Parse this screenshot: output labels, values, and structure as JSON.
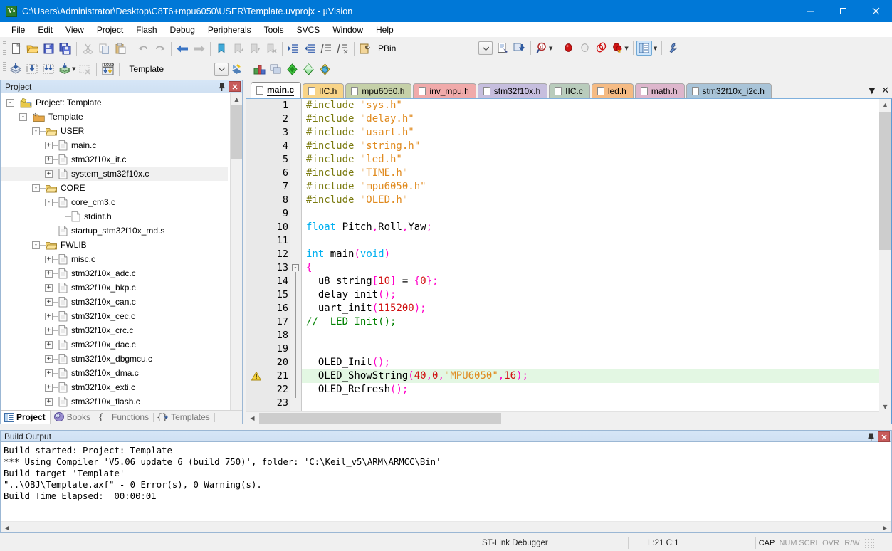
{
  "window": {
    "title": "C:\\Users\\Administrator\\Desktop\\C8T6+mpu6050\\USER\\Template.uvprojx - µVision",
    "app_icon": "keil-uvision-icon",
    "minimize": "—",
    "maximize": "☐",
    "close": "✕",
    "titlebar_color": "#0078d7"
  },
  "menubar": {
    "items": [
      {
        "label": "File"
      },
      {
        "label": "Edit"
      },
      {
        "label": "View"
      },
      {
        "label": "Project"
      },
      {
        "label": "Flash"
      },
      {
        "label": "Debug"
      },
      {
        "label": "Peripherals"
      },
      {
        "label": "Tools"
      },
      {
        "label": "SVCS"
      },
      {
        "label": "Window"
      },
      {
        "label": "Help"
      }
    ]
  },
  "toolbar_main": {
    "buttons": [
      {
        "name": "new-file-icon",
        "tip": "New"
      },
      {
        "name": "open-file-icon",
        "tip": "Open"
      },
      {
        "name": "save-icon",
        "tip": "Save"
      },
      {
        "name": "save-all-icon",
        "tip": "Save All"
      },
      {
        "name": "cut-icon",
        "tip": "Cut"
      },
      {
        "name": "copy-icon",
        "tip": "Copy"
      },
      {
        "name": "paste-icon",
        "tip": "Paste"
      },
      {
        "name": "undo-icon",
        "tip": "Undo"
      },
      {
        "name": "redo-icon",
        "tip": "Redo"
      },
      {
        "name": "navigate-back-icon",
        "tip": "Back"
      },
      {
        "name": "navigate-forward-icon",
        "tip": "Forward"
      },
      {
        "name": "bookmark-toggle-icon",
        "tip": "Insert/Remove Bookmark"
      },
      {
        "name": "bookmark-prev-icon",
        "tip": "Previous Bookmark"
      },
      {
        "name": "bookmark-next-icon",
        "tip": "Next Bookmark"
      },
      {
        "name": "bookmark-clear-icon",
        "tip": "Clear All Bookmarks"
      },
      {
        "name": "indent-icon",
        "tip": "Indent"
      },
      {
        "name": "outdent-icon",
        "tip": "Outdent"
      },
      {
        "name": "comment-icon",
        "tip": "Comment"
      },
      {
        "name": "uncomment-icon",
        "tip": "Uncomment"
      },
      {
        "name": "configure-icon",
        "tip": "Configuration Wizard"
      }
    ],
    "pbin_label": "PBin"
  },
  "toolbar_build": {
    "buttons": [
      {
        "name": "translate-icon",
        "tip": "Translate"
      },
      {
        "name": "build-icon",
        "tip": "Build"
      },
      {
        "name": "rebuild-icon",
        "tip": "Rebuild"
      },
      {
        "name": "batch-build-icon",
        "tip": "Batch Build"
      },
      {
        "name": "stop-build-icon",
        "tip": "Stop Build"
      },
      {
        "name": "download-icon",
        "tip": "Download"
      }
    ],
    "target_value": "Template",
    "target_dropdown_icon": "chevron-down-icon",
    "right_buttons": [
      {
        "name": "target-options-icon",
        "tip": "Options for Target"
      },
      {
        "name": "manage-project-items-icon",
        "tip": "Manage Project Items"
      },
      {
        "name": "pack-installer-icon",
        "tip": "Pack Installer"
      },
      {
        "name": "manage-rte-icon",
        "tip": "Manage Run-Time Environment"
      },
      {
        "name": "select-software-packs-icon",
        "tip": "Select Software Packs"
      }
    ]
  },
  "toolbar_debug": {
    "buttons": [
      {
        "name": "file-info-icon",
        "tip": "Source Browser"
      },
      {
        "name": "debug-session-icon",
        "tip": "Start/Stop Debug Session"
      },
      {
        "name": "find-in-files-icon",
        "tip": "Find in Files"
      },
      {
        "name": "insert-breakpoint-icon",
        "tip": "Insert/Remove Breakpoint"
      },
      {
        "name": "disable-breakpoint-icon",
        "tip": "Enable/Disable Breakpoint"
      },
      {
        "name": "disable-all-breakpoints-icon",
        "tip": "Disable All Breakpoints"
      },
      {
        "name": "kill-all-breakpoints-icon",
        "tip": "Kill All Breakpoints"
      },
      {
        "name": "window-layout-icon",
        "tip": "Window Layout",
        "active": true
      },
      {
        "name": "configure-tools-icon",
        "tip": "Configure"
      }
    ]
  },
  "project_panel": {
    "title": "Project",
    "pin_icon": "pin-icon",
    "close_icon": "close-icon",
    "tree": [
      {
        "label": "Project: Template",
        "depth": 0,
        "toggle": "-",
        "icon": "project-icon",
        "selected": false
      },
      {
        "label": "Template",
        "depth": 1,
        "toggle": "-",
        "icon": "target-icon",
        "selected": false
      },
      {
        "label": "USER",
        "depth": 2,
        "toggle": "-",
        "icon": "folder-icon",
        "selected": false
      },
      {
        "label": "main.c",
        "depth": 3,
        "toggle": "+",
        "icon": "c-file-icon",
        "selected": false
      },
      {
        "label": "stm32f10x_it.c",
        "depth": 3,
        "toggle": "+",
        "icon": "c-file-icon",
        "selected": false
      },
      {
        "label": "system_stm32f10x.c",
        "depth": 3,
        "toggle": "+",
        "icon": "c-file-icon",
        "selected": true
      },
      {
        "label": "CORE",
        "depth": 2,
        "toggle": "-",
        "icon": "folder-icon",
        "selected": false
      },
      {
        "label": "core_cm3.c",
        "depth": 3,
        "toggle": "-",
        "icon": "c-file-icon",
        "selected": false
      },
      {
        "label": "stdint.h",
        "depth": 4,
        "toggle": "",
        "icon": "h-file-icon",
        "selected": false
      },
      {
        "label": "startup_stm32f10x_md.s",
        "depth": 3,
        "toggle": "",
        "icon": "asm-file-icon",
        "selected": false
      },
      {
        "label": "FWLIB",
        "depth": 2,
        "toggle": "-",
        "icon": "folder-icon",
        "selected": false
      },
      {
        "label": "misc.c",
        "depth": 3,
        "toggle": "+",
        "icon": "c-file-icon",
        "selected": false
      },
      {
        "label": "stm32f10x_adc.c",
        "depth": 3,
        "toggle": "+",
        "icon": "c-file-icon",
        "selected": false
      },
      {
        "label": "stm32f10x_bkp.c",
        "depth": 3,
        "toggle": "+",
        "icon": "c-file-icon",
        "selected": false
      },
      {
        "label": "stm32f10x_can.c",
        "depth": 3,
        "toggle": "+",
        "icon": "c-file-icon",
        "selected": false
      },
      {
        "label": "stm32f10x_cec.c",
        "depth": 3,
        "toggle": "+",
        "icon": "c-file-icon",
        "selected": false
      },
      {
        "label": "stm32f10x_crc.c",
        "depth": 3,
        "toggle": "+",
        "icon": "c-file-icon",
        "selected": false
      },
      {
        "label": "stm32f10x_dac.c",
        "depth": 3,
        "toggle": "+",
        "icon": "c-file-icon",
        "selected": false
      },
      {
        "label": "stm32f10x_dbgmcu.c",
        "depth": 3,
        "toggle": "+",
        "icon": "c-file-icon",
        "selected": false
      },
      {
        "label": "stm32f10x_dma.c",
        "depth": 3,
        "toggle": "+",
        "icon": "c-file-icon",
        "selected": false
      },
      {
        "label": "stm32f10x_exti.c",
        "depth": 3,
        "toggle": "+",
        "icon": "c-file-icon",
        "selected": false
      },
      {
        "label": "stm32f10x_flash.c",
        "depth": 3,
        "toggle": "+",
        "icon": "c-file-icon",
        "selected": false
      }
    ],
    "bottom_tabs": [
      {
        "label": "Project",
        "icon": "project-tab-icon",
        "active": true
      },
      {
        "label": "Books",
        "icon": "books-tab-icon",
        "active": false
      },
      {
        "label": "Functions",
        "icon": "functions-tab-icon",
        "active": false
      },
      {
        "label": "Templates",
        "icon": "templates-tab-icon",
        "active": false
      }
    ]
  },
  "editor": {
    "tabs": [
      {
        "label": "main.c",
        "color": "#ffffff",
        "active": true
      },
      {
        "label": "IIC.h",
        "color": "#f8d488",
        "active": false
      },
      {
        "label": "mpu6050.h",
        "color": "#c5d0a8",
        "active": false
      },
      {
        "label": "inv_mpu.h",
        "color": "#f0aaaa",
        "active": false
      },
      {
        "label": "stm32f10x.h",
        "color": "#c6bede",
        "active": false
      },
      {
        "label": "IIC.c",
        "color": "#b9ccbc",
        "active": false
      },
      {
        "label": "led.h",
        "color": "#f5bb84",
        "active": false
      },
      {
        "label": "math.h",
        "color": "#ddb6cc",
        "active": false
      },
      {
        "label": "stm32f10x_i2c.h",
        "color": "#a9c4d8",
        "active": false
      }
    ],
    "tab_list_icon": "tab-list-icon",
    "tab_close_icon": "close-icon",
    "lines": [
      {
        "n": "1",
        "tokens": [
          {
            "t": "#include ",
            "c": "pre"
          },
          {
            "t": "\"sys.h\"",
            "c": "str"
          }
        ]
      },
      {
        "n": "2",
        "tokens": [
          {
            "t": "#include ",
            "c": "pre"
          },
          {
            "t": "\"delay.h\"",
            "c": "str"
          }
        ]
      },
      {
        "n": "3",
        "tokens": [
          {
            "t": "#include ",
            "c": "pre"
          },
          {
            "t": "\"usart.h\"",
            "c": "str"
          }
        ]
      },
      {
        "n": "4",
        "tokens": [
          {
            "t": "#include ",
            "c": "pre"
          },
          {
            "t": "\"string.h\"",
            "c": "str"
          }
        ]
      },
      {
        "n": "5",
        "tokens": [
          {
            "t": "#include ",
            "c": "pre"
          },
          {
            "t": "\"led.h\"",
            "c": "str"
          }
        ]
      },
      {
        "n": "6",
        "tokens": [
          {
            "t": "#include ",
            "c": "pre"
          },
          {
            "t": "\"TIME.h\"",
            "c": "str"
          }
        ]
      },
      {
        "n": "7",
        "tokens": [
          {
            "t": "#include ",
            "c": "pre"
          },
          {
            "t": "\"mpu6050.h\"",
            "c": "str"
          }
        ]
      },
      {
        "n": "8",
        "tokens": [
          {
            "t": "#include ",
            "c": "pre"
          },
          {
            "t": "\"OLED.h\"",
            "c": "str"
          }
        ]
      },
      {
        "n": "9",
        "tokens": []
      },
      {
        "n": "10",
        "tokens": [
          {
            "t": "float",
            "c": "type"
          },
          {
            "t": " Pitch",
            "c": "txt"
          },
          {
            "t": ",",
            "c": "punc"
          },
          {
            "t": "Roll",
            "c": "txt"
          },
          {
            "t": ",",
            "c": "punc"
          },
          {
            "t": "Yaw",
            "c": "txt"
          },
          {
            "t": ";",
            "c": "punc"
          }
        ]
      },
      {
        "n": "11",
        "tokens": []
      },
      {
        "n": "12",
        "tokens": [
          {
            "t": "int",
            "c": "type"
          },
          {
            "t": " main",
            "c": "txt"
          },
          {
            "t": "(",
            "c": "punc"
          },
          {
            "t": "void",
            "c": "type"
          },
          {
            "t": ")",
            "c": "punc"
          }
        ]
      },
      {
        "n": "13",
        "tokens": [
          {
            "t": "{",
            "c": "punc"
          }
        ],
        "fold": true
      },
      {
        "n": "14",
        "tokens": [
          {
            "t": "  u8 string",
            "c": "txt"
          },
          {
            "t": "[",
            "c": "punc"
          },
          {
            "t": "10",
            "c": "num"
          },
          {
            "t": "]",
            "c": "punc"
          },
          {
            "t": " = ",
            "c": "txt"
          },
          {
            "t": "{",
            "c": "punc"
          },
          {
            "t": "0",
            "c": "num"
          },
          {
            "t": "}",
            "c": "punc"
          },
          {
            "t": ";",
            "c": "punc"
          }
        ]
      },
      {
        "n": "15",
        "tokens": [
          {
            "t": "  delay_init",
            "c": "txt"
          },
          {
            "t": "()",
            "c": "punc"
          },
          {
            "t": ";",
            "c": "punc"
          }
        ]
      },
      {
        "n": "16",
        "tokens": [
          {
            "t": "  uart_init",
            "c": "txt"
          },
          {
            "t": "(",
            "c": "punc"
          },
          {
            "t": "115200",
            "c": "num"
          },
          {
            "t": ")",
            "c": "punc"
          },
          {
            "t": ";",
            "c": "punc"
          }
        ]
      },
      {
        "n": "17",
        "tokens": [
          {
            "t": "//  LED_Init();",
            "c": "cmt"
          }
        ],
        "nogutter": true
      },
      {
        "n": "18",
        "tokens": []
      },
      {
        "n": "19",
        "tokens": []
      },
      {
        "n": "20",
        "tokens": [
          {
            "t": "  OLED_Init",
            "c": "txt"
          },
          {
            "t": "()",
            "c": "punc"
          },
          {
            "t": ";",
            "c": "punc"
          }
        ]
      },
      {
        "n": "21",
        "tokens": [
          {
            "t": "  OLED_ShowString",
            "c": "txt"
          },
          {
            "t": "(",
            "c": "punc"
          },
          {
            "t": "40",
            "c": "num"
          },
          {
            "t": ",",
            "c": "punc"
          },
          {
            "t": "0",
            "c": "num"
          },
          {
            "t": ",",
            "c": "punc"
          },
          {
            "t": "\"MPU6050\"",
            "c": "str"
          },
          {
            "t": ",",
            "c": "punc"
          },
          {
            "t": "16",
            "c": "num"
          },
          {
            "t": ")",
            "c": "punc"
          },
          {
            "t": ";",
            "c": "punc"
          }
        ],
        "highlight": true,
        "warning": true
      },
      {
        "n": "22",
        "tokens": [
          {
            "t": "  OLED_Refresh",
            "c": "txt"
          },
          {
            "t": "()",
            "c": "punc"
          },
          {
            "t": ";",
            "c": "punc"
          }
        ]
      },
      {
        "n": "23",
        "tokens": []
      }
    ],
    "warning_icon": "warning-triangle-icon",
    "highlight_color": "#e3f7e3"
  },
  "build_output": {
    "title": "Build Output",
    "pin_icon": "pin-icon",
    "close_icon": "close-icon",
    "lines": [
      "Build started: Project: Template",
      "*** Using Compiler 'V5.06 update 6 (build 750)', folder: 'C:\\Keil_v5\\ARM\\ARMCC\\Bin'",
      "Build target 'Template'",
      "\"..\\OBJ\\Template.axf\" - 0 Error(s), 0 Warning(s).",
      "Build Time Elapsed:  00:00:01"
    ]
  },
  "statusbar": {
    "debugger": "ST-Link Debugger",
    "cursor": "L:21 C:1",
    "flags": [
      {
        "label": "CAP",
        "on": true
      },
      {
        "label": "NUM",
        "on": false
      },
      {
        "label": "SCRL",
        "on": false
      },
      {
        "label": "OVR",
        "on": false
      },
      {
        "label": "R/W",
        "on": false
      }
    ],
    "resize_grip": "resize-grip-icon"
  }
}
